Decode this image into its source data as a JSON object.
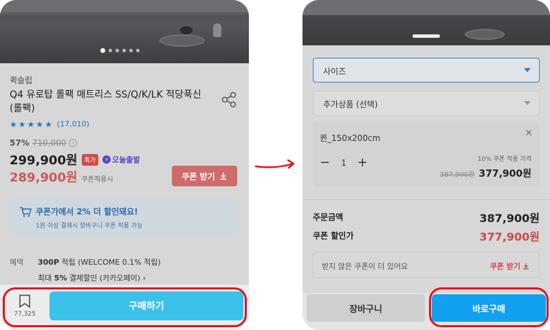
{
  "left": {
    "brand": "퀵슬립",
    "title": "Q4 유로탑 롤팩 매트리스 SS/Q/K/LK 적당푹신 (롤팩)",
    "review_count": "(17,010)",
    "discount_pct": "57%",
    "original_price": "710,000",
    "price": "299,900원",
    "special_tag": "특가",
    "today_tag": "오늘출발",
    "coupon_price": "289,900원",
    "coupon_applied": "쿠폰적용시",
    "coupon_button": "쿠폰 받기",
    "promo_title": "쿠폰가에서 2% 더 할인돼요!",
    "promo_sub": "1원 이상 결제시 장바구니 쿠폰 적용 가능",
    "benefit_label": "혜택",
    "benefit_points": "300P",
    "benefit_points_rest": "적립 (WELCOME 0.1% 적립)",
    "benefit_pay_prefix": "최대",
    "benefit_pay_pct": "5%",
    "benefit_pay_rest": "결제할인 (카카오페이) ›",
    "wish_count": "77,325",
    "buy_button": "구매하기"
  },
  "right": {
    "size_select": "사이즈",
    "extra_select": "추가상품 (선택)",
    "option_name": "퀸_150x200cm",
    "quantity": "1",
    "option_discount_label": "10% 쿠폰 적용 가격",
    "option_original": "387,900원",
    "option_price": "377,900원",
    "order_total_label": "주문금액",
    "order_total": "387,900원",
    "coupon_discount_label": "쿠폰 할인가",
    "coupon_discount": "377,900원",
    "unclaimed_text": "받지 않은 쿠폰이 더 있어요",
    "unclaimed_link": "쿠폰 받기",
    "cart_button": "장바구니",
    "buynow_button": "바로구매"
  },
  "colors": {
    "highlight": "#e0121e",
    "buy_button": "#3ac1ea",
    "buynow_button": "#12a0f0",
    "coupon_red": "#c94a4a"
  },
  "icons": [
    "share-icon",
    "star-icon",
    "info-icon",
    "bolt-icon",
    "cart-icon",
    "download-icon",
    "bookmark-icon",
    "close-icon",
    "minus-icon",
    "plus-icon",
    "chevron-down-icon",
    "arrow-icon"
  ]
}
